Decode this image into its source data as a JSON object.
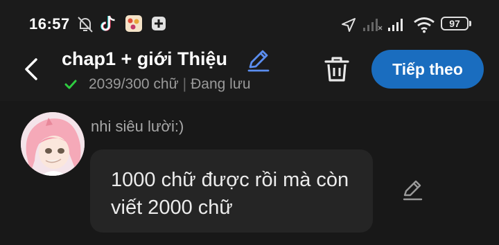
{
  "status_bar": {
    "time": "16:57",
    "battery": "97",
    "icons": [
      "bell-off-icon",
      "tiktok-icon",
      "app-icon",
      "plus-badge-icon",
      "location-arrow-icon",
      "signal-icon",
      "signal-icon",
      "wifi-icon",
      "battery-icon"
    ]
  },
  "header": {
    "title": "chap1 + giới Thiệu",
    "word_count": "2039/300 chữ",
    "separator": "|",
    "save_status": "Đang lưu",
    "next_label": "Tiếp theo",
    "accent_color": "#1a6dbf",
    "check_color": "#2ecc40"
  },
  "comment": {
    "username": "nhi siêu lười:)",
    "text": "1000 chữ được rồi mà còn viết 2000 chữ"
  }
}
